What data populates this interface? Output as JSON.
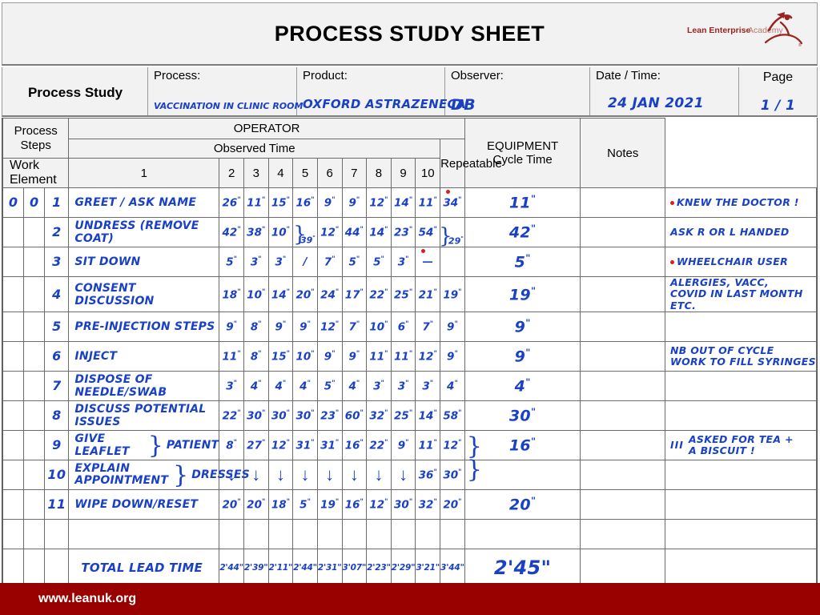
{
  "header": {
    "title": "PROCESS STUDY SHEET",
    "logo_line1": "Lean Enterprise",
    "logo_line2": "Academy",
    "logo_reg": "®"
  },
  "info": {
    "study_label": "Process Study",
    "process_label": "Process:",
    "process_value": "VACCINATION IN CLINIC ROOM",
    "product_label": "Product:",
    "product_value": "OXFORD ASTRAZENECA",
    "observer_label": "Observer:",
    "observer_value": "DB",
    "date_label": "Date / Time:",
    "date_value": "24 JAN 2021",
    "page_label": "Page",
    "page_value": "1  /  1"
  },
  "columns": {
    "process_steps": "Process\nSteps",
    "process_steps_l1": "Process",
    "process_steps_l2": "Steps",
    "work_element": "Work Element",
    "operator": "OPERATOR",
    "observed_time": "Observed Time",
    "observation_numbers": [
      "1",
      "2",
      "3",
      "4",
      "5",
      "6",
      "7",
      "8",
      "9",
      "10"
    ],
    "repeatable": "Repeatable",
    "equipment_l1": "EQUIPMENT",
    "equipment_l2": "Cycle Time",
    "notes": "Notes"
  },
  "rows": [
    {
      "ps_a": "0",
      "ps_b": "0",
      "ps_c": "1",
      "element": "GREET / ASK NAME",
      "times": [
        "26",
        "11",
        "15",
        "16",
        "9",
        "9",
        "12",
        "14",
        "11",
        "34"
      ],
      "red_dot_on": 9,
      "repeatable": "11",
      "equipment": "",
      "notes": "KNEW THE DOCTOR !",
      "notes_bullet": true
    },
    {
      "ps_a": "",
      "ps_b": "",
      "ps_c": "2",
      "element": "UNDRESS (REMOVE COAT)",
      "times": [
        "42",
        "38",
        "10",
        "",
        "12",
        "44",
        "14",
        "23",
        "54",
        ""
      ],
      "repeatable": "42",
      "equipment": "",
      "notes": "ASK R OR L HANDED",
      "notes_bullet": false,
      "brace_col4": "39",
      "brace_col10": "29"
    },
    {
      "ps_a": "",
      "ps_b": "",
      "ps_c": "3",
      "element": "SIT DOWN",
      "times": [
        "5",
        "3",
        "3",
        "/",
        "7",
        "5",
        "5",
        "3",
        "—",
        ""
      ],
      "red_dot_on": 8,
      "repeatable": "5",
      "equipment": "",
      "notes": "WHEELCHAIR USER",
      "notes_bullet": true
    },
    {
      "ps_a": "",
      "ps_b": "",
      "ps_c": "4",
      "element": "CONSENT DISCUSSION",
      "times": [
        "18",
        "10",
        "14",
        "20",
        "24",
        "17",
        "22",
        "25",
        "21",
        "19"
      ],
      "repeatable": "19",
      "equipment": "",
      "notes": "ALERGIES, VACC,\nCOVID IN LAST MONTH ETC.",
      "notes_bullet": false
    },
    {
      "ps_a": "",
      "ps_b": "",
      "ps_c": "5",
      "element": "PRE-INJECTION STEPS",
      "times": [
        "9",
        "8",
        "9",
        "9",
        "12",
        "7",
        "10",
        "6",
        "7",
        "9"
      ],
      "repeatable": "9",
      "equipment": "",
      "notes": "",
      "notes_bullet": false
    },
    {
      "ps_a": "",
      "ps_b": "",
      "ps_c": "6",
      "element": "INJECT",
      "times": [
        "11",
        "8",
        "15",
        "10",
        "9",
        "9",
        "11",
        "11",
        "12",
        "9"
      ],
      "repeatable": "9",
      "equipment": "",
      "notes": "NB OUT OF CYCLE\nWORK TO FILL SYRINGES",
      "notes_bullet": false
    },
    {
      "ps_a": "",
      "ps_b": "",
      "ps_c": "7",
      "element": "DISPOSE OF NEEDLE/SWAB",
      "times": [
        "3",
        "4",
        "4",
        "4",
        "5",
        "4",
        "3",
        "3",
        "3",
        "4"
      ],
      "repeatable": "4",
      "equipment": "",
      "notes": "",
      "notes_bullet": false
    },
    {
      "ps_a": "",
      "ps_b": "",
      "ps_c": "8",
      "element": "DISCUSS POTENTIAL ISSUES",
      "times": [
        "22",
        "30",
        "30",
        "30",
        "23",
        "60",
        "32",
        "25",
        "14",
        "58"
      ],
      "repeatable": "30",
      "equipment": "",
      "notes": "",
      "notes_bullet": false
    },
    {
      "ps_a": "",
      "ps_b": "",
      "ps_c": "9",
      "element": "GIVE LEAFLET",
      "element_sub": "PATIENT",
      "times": [
        "8",
        "27",
        "12",
        "31",
        "31",
        "16",
        "22",
        "9",
        "11",
        "12"
      ],
      "repeatable": "16",
      "equipment": "",
      "notes": "ASKED FOR TEA +\nA BISCUIT !",
      "notes_tally": "III",
      "notes_bullet": false
    },
    {
      "ps_a": "",
      "ps_b": "",
      "ps_c": "10",
      "element": "EXPLAIN\nAPPOINTMENT",
      "element_sub": "DRESSES",
      "times": [
        "↓",
        "↓",
        "↓",
        "↓",
        "↓",
        "↓",
        "↓",
        "↓",
        "36",
        "30"
      ],
      "repeatable": "",
      "equipment": "",
      "notes": "",
      "notes_bullet": false
    },
    {
      "ps_a": "",
      "ps_b": "",
      "ps_c": "11",
      "element": "WIPE DOWN/RESET",
      "times": [
        "20",
        "20",
        "18",
        "5",
        "19",
        "16",
        "12",
        "30",
        "32",
        "20"
      ],
      "repeatable": "20",
      "equipment": "",
      "notes": "",
      "notes_bullet": false
    },
    {
      "ps_a": "",
      "ps_b": "",
      "ps_c": "",
      "element": "",
      "times": [
        "",
        "",
        "",
        "",
        "",
        "",
        "",
        "",
        "",
        ""
      ],
      "repeatable": "",
      "equipment": "",
      "notes": "",
      "notes_bullet": false
    }
  ],
  "total_row": {
    "label": "TOTAL LEAD TIME",
    "times": [
      "2'44\"",
      "2'39\"",
      "2'11\"",
      "2'44\"",
      "2'31\"",
      "3'07\"",
      "2'23\"",
      "2'29\"",
      "3'21\"",
      "3'44\""
    ],
    "repeatable": "2'45\""
  },
  "blank_row_after_total": true,
  "footer": {
    "url": "www.leanuk.org"
  },
  "colors": {
    "footer_red": "#990000",
    "ink_blue": "#1a41c4",
    "ink_red": "#e01b1b",
    "logo_red": "#9c2420",
    "header_grey": "#f2f2f2"
  }
}
